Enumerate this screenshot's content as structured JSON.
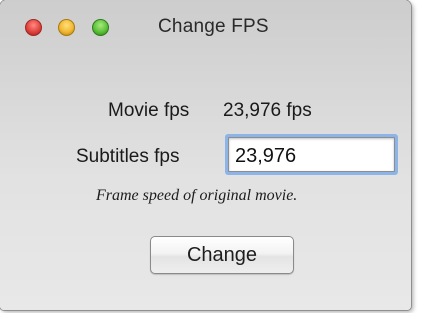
{
  "window": {
    "title": "Change FPS"
  },
  "movie_fps": {
    "label": "Movie fps",
    "value": "23,976 fps"
  },
  "subtitles_fps": {
    "label": "Subtitles fps",
    "value": "23,976"
  },
  "hint": "Frame speed of original movie.",
  "buttons": {
    "change_label": "Change"
  },
  "icons": {
    "close": "close-traffic-light",
    "minimize": "minimize-traffic-light",
    "zoom": "zoom-traffic-light"
  },
  "colors": {
    "close": "#e0443e",
    "minimize": "#f1b833",
    "zoom": "#5ec13a",
    "focus_ring": "#8db4e6"
  }
}
